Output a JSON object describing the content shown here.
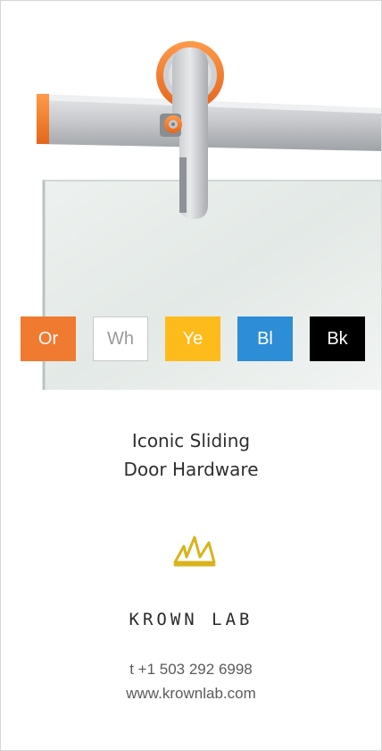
{
  "photo": {
    "image": "sliding-door-hardware-photo"
  },
  "swatches": [
    {
      "label": "Or",
      "bg": "#f07a2f",
      "fg": "#ffffff",
      "border": "#f07a2f"
    },
    {
      "label": "Wh",
      "bg": "#ffffff",
      "fg": "#9a9a9a",
      "border": "#c8c8c8"
    },
    {
      "label": "Ye",
      "bg": "#fdbb1c",
      "fg": "#ffffff",
      "border": "#fdbb1c"
    },
    {
      "label": "Bl",
      "bg": "#2d8dd6",
      "fg": "#ffffff",
      "border": "#2d8dd6"
    },
    {
      "label": "Bk",
      "bg": "#000000",
      "fg": "#ffffff",
      "border": "#000000"
    }
  ],
  "title": {
    "line1": "Iconic Sliding",
    "line2": "Door Hardware"
  },
  "logo": {
    "icon": "crown-icon",
    "color": "#d8b31c"
  },
  "brand": {
    "name": "KROWN LAB"
  },
  "contact": {
    "phone": "t +1 503 292 6998",
    "website": "www.krownlab.com"
  }
}
